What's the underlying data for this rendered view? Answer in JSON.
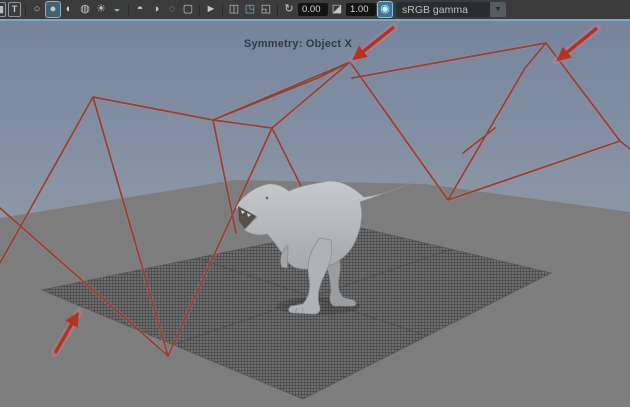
{
  "toolbar": {
    "caret_glyph": "▼",
    "items": [
      {
        "type": "icon",
        "name": "film-gate-icon",
        "glyph": "▦",
        "partial": true,
        "boxed": true
      },
      {
        "type": "icon",
        "name": "safe-title-icon",
        "glyph": "T",
        "boxed": true
      },
      {
        "type": "sep"
      },
      {
        "type": "icon",
        "name": "wireframe-mode-icon",
        "glyph": "○"
      },
      {
        "type": "icon",
        "name": "shaded-mode-icon",
        "glyph": "●",
        "active": true
      },
      {
        "type": "icon",
        "name": "textured-mode-icon",
        "glyph": "◐"
      },
      {
        "type": "icon",
        "name": "default-material-icon",
        "glyph": "◍"
      },
      {
        "type": "icon",
        "name": "lights-icon",
        "glyph": "☀"
      },
      {
        "type": "icon",
        "name": "shadows-icon",
        "glyph": "◒",
        "accent": true
      },
      {
        "type": "sep"
      },
      {
        "type": "icon",
        "name": "ssao-icon",
        "glyph": "◓"
      },
      {
        "type": "icon",
        "name": "motion-blur-icon",
        "glyph": "◑"
      },
      {
        "type": "icon",
        "name": "antialiasing-icon",
        "glyph": "◌",
        "accent": true
      },
      {
        "type": "icon",
        "name": "depth-of-field-icon",
        "glyph": "▢"
      },
      {
        "type": "sep"
      },
      {
        "type": "icon",
        "name": "isolate-select-icon",
        "glyph": "►"
      },
      {
        "type": "sep"
      },
      {
        "type": "icon",
        "name": "xray-icon",
        "glyph": "◫"
      },
      {
        "type": "icon",
        "name": "xray-joints-icon",
        "glyph": "◳",
        "accent": true
      },
      {
        "type": "icon",
        "name": "xray-active-icon",
        "glyph": "◱"
      },
      {
        "type": "sep"
      },
      {
        "type": "icon",
        "name": "exposure-icon",
        "glyph": "↻"
      },
      {
        "type": "field",
        "name": "exposure-field",
        "value": "0.00"
      },
      {
        "type": "icon",
        "name": "gamma-icon",
        "glyph": "◪"
      },
      {
        "type": "field",
        "name": "gamma-field",
        "value": "1.00"
      },
      {
        "type": "icon",
        "name": "view-transform-icon",
        "glyph": "◉",
        "toggled": true
      },
      {
        "type": "dropdown",
        "name": "view-transform-dropdown",
        "value": "sRGB gamma"
      }
    ]
  },
  "viewport": {
    "message": "Symmetry: Object X"
  },
  "colors": {
    "toolbar_bg": "#3b3b3b",
    "active_highlight_blue": "#7cc4e4",
    "viewport_border_blue": "#7ca7c2",
    "sky_top": "#76849c",
    "sky_bottom": "#a4a9af",
    "ground_gray": "#7d7d7d",
    "wireframe_red": "#8e4434",
    "arrow_red": "#b5321f",
    "dino_gray": "#b8bbbd",
    "message_text": "#333a46"
  }
}
